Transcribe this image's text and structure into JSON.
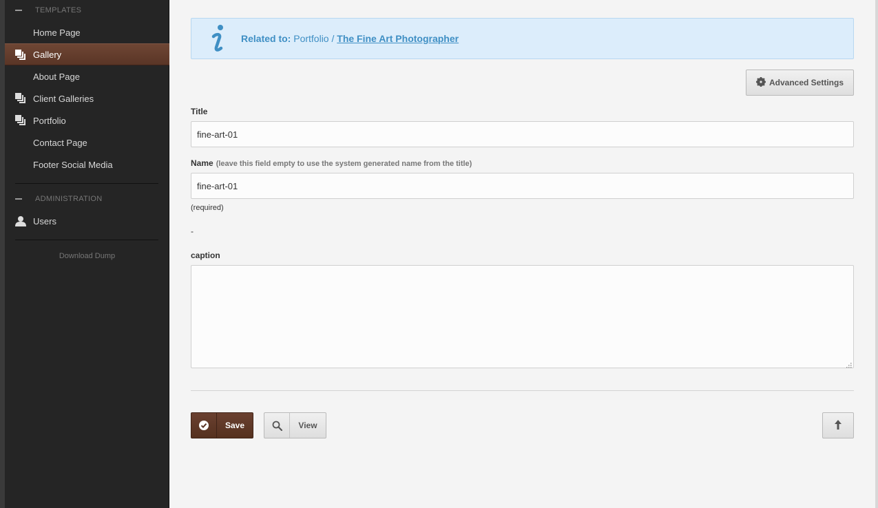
{
  "sidebar": {
    "sections": [
      {
        "title": "TEMPLATES"
      },
      {
        "title": "ADMINISTRATION"
      }
    ],
    "items": [
      {
        "label": "Home Page",
        "icon": ""
      },
      {
        "label": "Gallery",
        "icon": "stack-icon",
        "active": true
      },
      {
        "label": "About Page",
        "icon": ""
      },
      {
        "label": "Client Galleries",
        "icon": "stack-icon"
      },
      {
        "label": "Portfolio",
        "icon": "stack-icon"
      },
      {
        "label": "Contact Page",
        "icon": ""
      },
      {
        "label": "Footer Social Media",
        "icon": ""
      }
    ],
    "admin_items": [
      {
        "label": "Users",
        "icon": "user-icon"
      }
    ],
    "download": "Download Dump",
    "active_color": "#5f3a2a"
  },
  "info": {
    "prefix": "Related to:",
    "parent": "Portfolio /",
    "link": "The Fine Art Photographer",
    "color": "#3f8fc4",
    "icon": "info-icon"
  },
  "toolbar": {
    "advanced_label": "Advanced Settings"
  },
  "form": {
    "title_label": "Title",
    "title_value": "fine-art-01",
    "name_label": "Name",
    "name_hint": "(leave this field empty to use the system generated name from the title)",
    "name_value": "fine-art-01",
    "required_note": "(required)",
    "dash": "-",
    "caption_label": "caption",
    "caption_value": ""
  },
  "actions": {
    "save_label": "Save",
    "view_label": "View",
    "save_color": "#5f3a2a"
  }
}
